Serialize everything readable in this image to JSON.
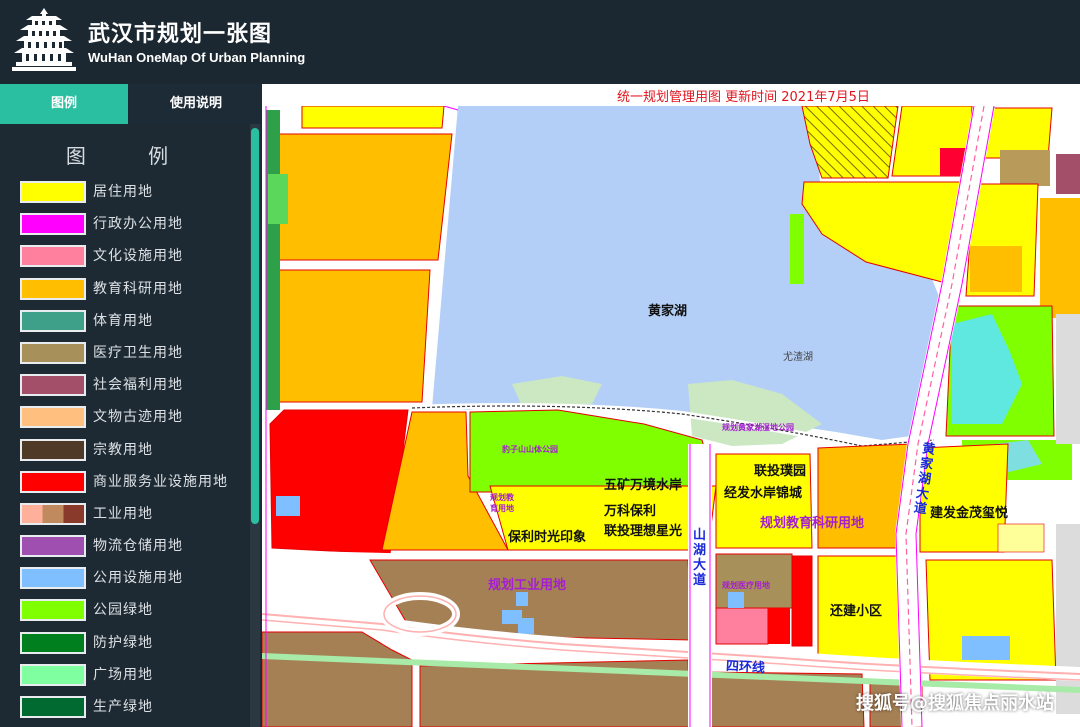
{
  "header": {
    "title": "武汉市规划一张图",
    "subtitle": "WuHan OneMap Of Urban Planning"
  },
  "tabs": [
    {
      "label": "图例",
      "active": true
    },
    {
      "label": "使用说明",
      "active": false
    }
  ],
  "legend": {
    "heading": "图 例",
    "items": [
      {
        "label": "居住用地",
        "color": "#ffff00"
      },
      {
        "label": "行政办公用地",
        "color": "#ff00ff"
      },
      {
        "label": "文化设施用地",
        "color": "#ff7f9f"
      },
      {
        "label": "教育科研用地",
        "color": "#ffbf00"
      },
      {
        "label": "体育用地",
        "color": "#3fa08a"
      },
      {
        "label": "医疗卫生用地",
        "color": "#a8905a"
      },
      {
        "label": "社会福利用地",
        "color": "#a44f6a"
      },
      {
        "label": "文物古迹用地",
        "color": "#ffbf7f"
      },
      {
        "label": "宗教用地",
        "color": "#4f3a28"
      },
      {
        "label": "商业服务业设施用地",
        "color": "#ff0000"
      },
      {
        "label": "工业用地",
        "colors": [
          "#ffb09a",
          "#c08a5e",
          "#8a3a2a"
        ]
      },
      {
        "label": "物流仓储用地",
        "color": "#9f4fb0"
      },
      {
        "label": "公用设施用地",
        "color": "#7fbfff"
      },
      {
        "label": "公园绿地",
        "color": "#7fff00"
      },
      {
        "label": "防护绿地",
        "color": "#007f1f"
      },
      {
        "label": "广场用地",
        "color": "#7fff9f"
      },
      {
        "label": "生产绿地",
        "color": "#006a30"
      }
    ]
  },
  "map": {
    "caption": "统一规划管理用图 更新时间 2021年7月5日",
    "labels": {
      "huangjiahu": "黄家湖",
      "youzhahu": "尤渣湖",
      "wetland_park": "规划黄家湖湿地公园",
      "baozishan_park": "豹子山山体公园",
      "wukuang": "五矿万境水岸",
      "wanke": "万科保利",
      "liantou_lixiang": "联投理想星光",
      "baoli_shiguang": "保利时光印象",
      "planned_edu_small": "规划教育用地",
      "liantou_puyuan": "联投璞园",
      "jingfa": "经发水岸锦城",
      "planned_edu": "规划教育科研用地",
      "huangjiahu_avenue": "黄家湖大道",
      "jianfa_jinmao": "建发金茂玺悦",
      "shanhu_avenue": "山湖大道",
      "planned_medical": "规划医疗用地",
      "planned_industrial": "规划工业用地",
      "huanjian": "还建小区",
      "sihuanxian": "四环线"
    },
    "watermark": "搜狐号@搜狐焦点丽水站"
  }
}
